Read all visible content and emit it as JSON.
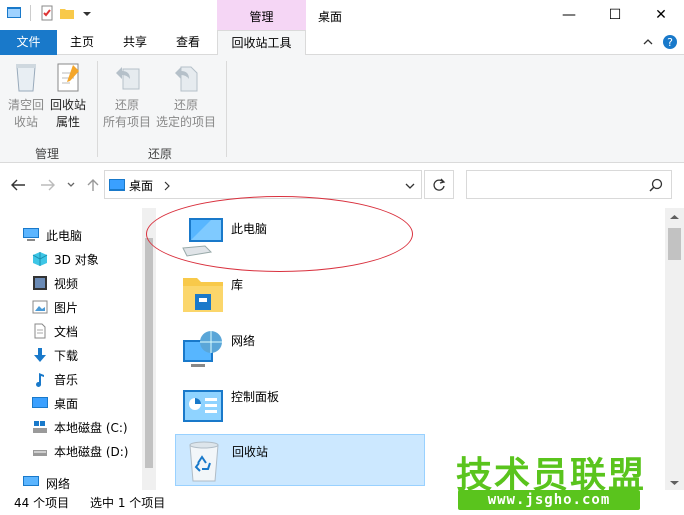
{
  "titlebar": {
    "context_group": "管理",
    "title": "桌面",
    "minimize": "—",
    "maximize": "☐",
    "close": "✕"
  },
  "tabs": {
    "file": "文件",
    "home": "主页",
    "share": "共享",
    "view": "查看",
    "tools": "回收站工具"
  },
  "ribbon": {
    "empty_line1": "清空回",
    "empty_line2": "收站",
    "props_line1": "回收站",
    "props_line2": "属性",
    "group_manage": "管理",
    "restore_all_line1": "还原",
    "restore_all_line2": "所有项目",
    "restore_sel_line1": "还原",
    "restore_sel_line2": "选定的项目",
    "group_restore": "还原"
  },
  "address": {
    "location": "桌面"
  },
  "sidebar": {
    "items": [
      {
        "label": "此电脑"
      },
      {
        "label": "3D 对象"
      },
      {
        "label": "视频"
      },
      {
        "label": "图片"
      },
      {
        "label": "文档"
      },
      {
        "label": "下载"
      },
      {
        "label": "音乐"
      },
      {
        "label": "桌面"
      },
      {
        "label": "本地磁盘 (C:)"
      },
      {
        "label": "本地磁盘 (D:)"
      },
      {
        "label": "网络"
      }
    ]
  },
  "files": [
    {
      "name": "此电脑"
    },
    {
      "name": "库"
    },
    {
      "name": "网络"
    },
    {
      "name": "控制面板"
    },
    {
      "name": "回收站"
    }
  ],
  "status": {
    "count": "44 个项目",
    "selected": "选中 1 个项目"
  },
  "watermark": {
    "brand": "技术员联盟",
    "url": "www.jsgho.com"
  },
  "colors": {
    "accent": "#1979ca",
    "context": "#f5d6f5",
    "selection": "#cce8ff",
    "annotation": "#d9313e",
    "watermark": "#5ac41d"
  }
}
